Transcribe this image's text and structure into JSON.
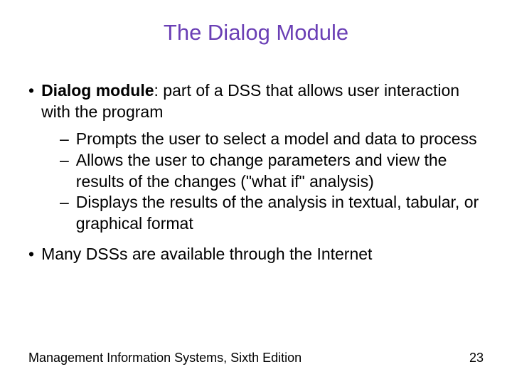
{
  "title": "The Dialog Module",
  "bullets": [
    {
      "boldTerm": "Dialog module",
      "afterBold": ": part of a DSS that allows user interaction with the program",
      "subs": [
        "Prompts the user to select a model and data to process",
        "Allows the user to change parameters and view the results of the changes (\"what if\" analysis)",
        "Displays the results of the analysis in textual, tabular, or graphical format"
      ]
    },
    {
      "plain": "Many DSSs are available through the Internet",
      "subs": []
    }
  ],
  "footer": {
    "source": "Management Information Systems, Sixth Edition",
    "page": "23"
  }
}
